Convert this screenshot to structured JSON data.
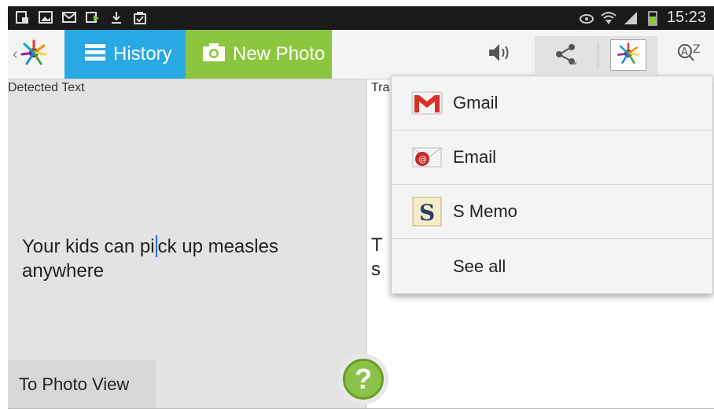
{
  "status_bar": {
    "time": "15:23",
    "left_icons": [
      "clipboard-icon",
      "image-icon",
      "mail-icon",
      "forward-icon",
      "download-icon",
      "bag-check-icon"
    ],
    "right_icons": [
      "eye-icon",
      "wifi-icon",
      "signal-icon",
      "battery-icon"
    ]
  },
  "action_bar": {
    "history_label": "History",
    "new_photo_label": "New Photo",
    "colors": {
      "history_tab": "#29a9e3",
      "new_photo_tab": "#8cc63f"
    }
  },
  "left_panel": {
    "header": "Detected Text",
    "text_before_cursor": "Your kids can pi",
    "text_after_cursor": "ck up measles anywhere",
    "photo_view_button": "To Photo View"
  },
  "right_panel": {
    "header_partial": "Tra",
    "line1_partial": "T",
    "line2_partial": "s"
  },
  "share_menu": {
    "items": [
      {
        "label": "Gmail",
        "icon": "gmail-icon"
      },
      {
        "label": "Email",
        "icon": "email-icon"
      },
      {
        "label": "S Memo",
        "icon": "s-memo-icon"
      },
      {
        "label": "See all",
        "icon": ""
      }
    ]
  },
  "help_button": {
    "glyph": "?"
  }
}
